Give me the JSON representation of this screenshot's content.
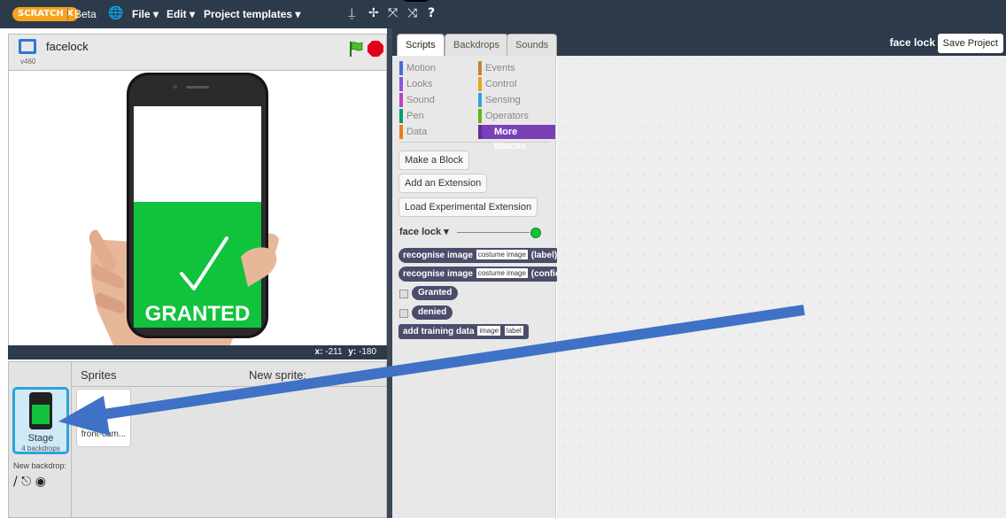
{
  "topbar": {
    "logo": "SCRATCH X",
    "beta": "Beta",
    "globe_icon": "globe-icon",
    "menus": [
      "File ▾",
      "Edit ▾",
      "Project templates ▾"
    ],
    "tools": [
      "⍊",
      "✢",
      "⤧",
      "⤨",
      "?"
    ]
  },
  "stage": {
    "project_title": "facelock",
    "version": "v460",
    "screen_text": "GRANTED",
    "coords_x_label": "x:",
    "coords_x": "-211",
    "coords_y_label": "y:",
    "coords_y": "-180"
  },
  "sprites": {
    "title": "Sprites",
    "new_sprite": "New sprite:",
    "stage_label": "Stage",
    "stage_sub": "4 backdrops",
    "new_backdrop": "New backdrop:",
    "sprite_name": "front-cam..."
  },
  "tabs": [
    "Scripts",
    "Backdrops",
    "Sounds"
  ],
  "project_name": "face lock",
  "save_label": "Save Project",
  "categories": [
    {
      "label": "Motion",
      "color": "#4a6cd4"
    },
    {
      "label": "Events",
      "color": "#c88330"
    },
    {
      "label": "Looks",
      "color": "#8a55d7"
    },
    {
      "label": "Control",
      "color": "#e1a91a"
    },
    {
      "label": "Sound",
      "color": "#bb42c3"
    },
    {
      "label": "Sensing",
      "color": "#2ca5e2"
    },
    {
      "label": "Pen",
      "color": "#0e9a6c"
    },
    {
      "label": "Operators",
      "color": "#5cb712"
    },
    {
      "label": "Data",
      "color": "#ee7d16"
    },
    {
      "label": "More Blocks",
      "color": "#632d99"
    }
  ],
  "palette_buttons": [
    "Make a Block",
    "Add an Extension",
    "Load Experimental Extension"
  ],
  "extension": {
    "name": "face lock ▾"
  },
  "blocks": {
    "b1_text": "recognise image",
    "b1_slot": "costume image",
    "b1_tail": "(label)",
    "b2_text": "recognise image",
    "b2_slot": "costume image",
    "b2_tail": "(confidence)",
    "r1": "Granted",
    "r2": "denied",
    "b3_text": "add training data",
    "b3_slot1": "image",
    "b3_slot2": "label"
  }
}
